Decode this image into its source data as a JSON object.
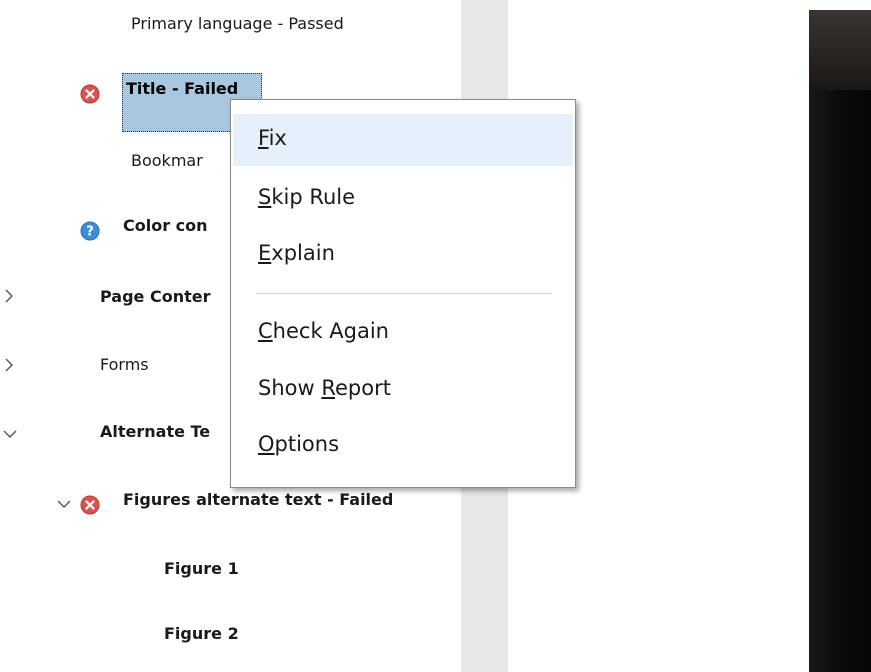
{
  "tree": {
    "items": [
      {
        "label": "Primary language - Passed"
      },
      {
        "label": "Title - Failed"
      },
      {
        "label": "Bookmar"
      },
      {
        "label": "Color con"
      },
      {
        "label": "Page Conter"
      },
      {
        "label": "Forms"
      },
      {
        "label": "Alternate Te"
      },
      {
        "label": "Figures alternate text - Failed"
      },
      {
        "label": "Figure 1"
      },
      {
        "label": "Figure 2"
      }
    ]
  },
  "context_menu": {
    "items": [
      {
        "accel": "F",
        "rest": "ix"
      },
      {
        "accel": "S",
        "rest": "kip Rule"
      },
      {
        "accel": "E",
        "rest": "xplain"
      },
      {
        "accel": "C",
        "rest": "heck Again"
      },
      {
        "pre": "Show ",
        "accel": "R",
        "rest": "eport"
      },
      {
        "accel": "O",
        "rest": "ptions"
      }
    ]
  },
  "colors": {
    "selection": "#a8c8e2",
    "menu_hover": "#e5f0fb",
    "failed_icon": "#d9534f",
    "info_icon": "#3c8fd6"
  }
}
